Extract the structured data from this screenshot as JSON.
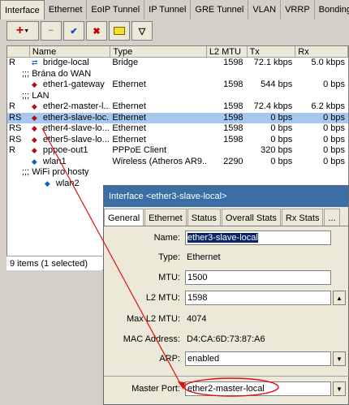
{
  "tabs": [
    "Interface",
    "Ethernet",
    "EoIP Tunnel",
    "IP Tunnel",
    "GRE Tunnel",
    "VLAN",
    "VRRP",
    "Bonding"
  ],
  "toolbar": {
    "add": "+",
    "remove": "−",
    "enable": "✔",
    "disable": "✖",
    "comment": "▭",
    "filter": "▽"
  },
  "columns": [
    "Name",
    "Type",
    "L2 MTU",
    "Tx",
    "Rx"
  ],
  "rows": [
    {
      "flag": "R",
      "name": "bridge-local",
      "type": "Bridge",
      "l2": "1598",
      "tx": "72.1 kbps",
      "rx": "5.0 kbps",
      "icon": "bridge-icon"
    },
    {
      "comment": ";;; Brána do WAN"
    },
    {
      "flag": "",
      "name": "ether1-gateway",
      "type": "Ethernet",
      "l2": "1598",
      "tx": "544 bps",
      "rx": "0 bps",
      "icon": "ethernet-icon"
    },
    {
      "comment": ";;; LAN"
    },
    {
      "flag": "R",
      "name": "ether2-master-l...",
      "type": "Ethernet",
      "l2": "1598",
      "tx": "72.4 kbps",
      "rx": "6.2 kbps",
      "icon": "ethernet-icon"
    },
    {
      "flag": "RS",
      "name": "ether3-slave-loc...",
      "type": "Ethernet",
      "l2": "1598",
      "tx": "0 bps",
      "rx": "0 bps",
      "icon": "ethernet-icon",
      "selected": true
    },
    {
      "flag": "RS",
      "name": "ether4-slave-lo...",
      "type": "Ethernet",
      "l2": "1598",
      "tx": "0 bps",
      "rx": "0 bps",
      "icon": "ethernet-icon"
    },
    {
      "flag": "RS",
      "name": "ether5-slave-lo...",
      "type": "Ethernet",
      "l2": "1598",
      "tx": "0 bps",
      "rx": "0 bps",
      "icon": "ethernet-icon"
    },
    {
      "flag": "R",
      "name": "pppoe-out1",
      "type": "PPPoE Client",
      "l2": "",
      "tx": "320 bps",
      "rx": "0 bps",
      "icon": "pppoe-icon"
    },
    {
      "flag": "",
      "name": "wlan1",
      "type": "Wireless (Atheros AR9...",
      "l2": "2290",
      "tx": "0 bps",
      "rx": "0 bps",
      "icon": "wireless-icon"
    },
    {
      "comment": ";;; WiFi pro hosty"
    },
    {
      "flag": "",
      "name": "wlan2",
      "type": "",
      "l2": "",
      "tx": "",
      "rx": "",
      "icon": "wireless-icon",
      "indent": true
    }
  ],
  "status": "9 items (1 selected)",
  "dialog": {
    "title": "Interface <ether3-slave-local>",
    "tabs": [
      "General",
      "Ethernet",
      "Status",
      "Overall Stats",
      "Rx Stats",
      "..."
    ],
    "name_label": "Name:",
    "name_value": "ether3-slave-local",
    "type_label": "Type:",
    "type_value": "Ethernet",
    "mtu_label": "MTU:",
    "mtu_value": "1500",
    "l2mtu_label": "L2 MTU:",
    "l2mtu_value": "1598",
    "maxl2_label": "Max L2 MTU:",
    "maxl2_value": "4074",
    "mac_label": "MAC Address:",
    "mac_value": "D4:CA:6D:73:87:A6",
    "arp_label": "ARP:",
    "arp_value": "enabled",
    "master_label": "Master Port:",
    "master_value": "ether2-master-local"
  },
  "colors": {
    "selection": "#a6c8f0",
    "title_bar": "#3a6ea5",
    "annotation": "#e01010"
  }
}
